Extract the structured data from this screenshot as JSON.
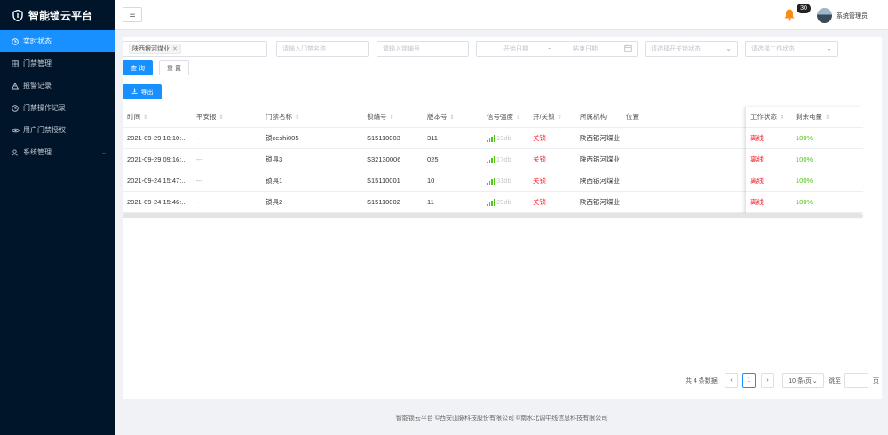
{
  "app": {
    "title": "智能锁云平台"
  },
  "sidebar": {
    "items": [
      {
        "label": "实时状态",
        "icon": "clock-icon",
        "active": true
      },
      {
        "label": "门禁管理",
        "icon": "grid-icon",
        "active": false
      },
      {
        "label": "报警记录",
        "icon": "warning-icon",
        "active": false
      },
      {
        "label": "门禁操作记录",
        "icon": "clock-icon",
        "active": false
      },
      {
        "label": "用户门禁授权",
        "icon": "eye-icon",
        "active": false
      },
      {
        "label": "系统管理",
        "icon": "user-icon",
        "active": false,
        "has_children": true
      }
    ]
  },
  "header": {
    "collapse_icon": "indent-icon",
    "notification_count": "30",
    "user_name": "系统管理员"
  },
  "filters": {
    "org_tag": "陕西银河煤业",
    "door_name_placeholder": "请输入门禁名称",
    "lock_no_placeholder": "请输入锁编号",
    "start_date_placeholder": "开始日期",
    "date_separator": "~",
    "end_date_placeholder": "结束日期",
    "lock_status_placeholder": "请选择开关锁状态",
    "work_status_placeholder": "请选择工作状态",
    "query_label": "查 询",
    "reset_label": "重 置",
    "export_label": "导出"
  },
  "table": {
    "columns": [
      "时间",
      "平安报",
      "门禁名称",
      "锁编号",
      "版本号",
      "信号强度",
      "开/关锁",
      "所属机构",
      "位置",
      "工作状态",
      "剩余电量"
    ],
    "rows": [
      {
        "time": "2021-09-29 10:10:...",
        "safety": "---",
        "door": "锁ceshi005",
        "lock_no": "S15110003",
        "version": "311",
        "signal": "19db",
        "lock_state": "关锁",
        "org": "陕西银河煤业",
        "location": "",
        "work": "离线",
        "battery": "100%"
      },
      {
        "time": "2021-09-29 09:16:...",
        "safety": "---",
        "door": "锁具3",
        "lock_no": "S32130006",
        "version": "025",
        "signal": "17db",
        "lock_state": "关锁",
        "org": "陕西银河煤业",
        "location": "",
        "work": "离线",
        "battery": "100%"
      },
      {
        "time": "2021-09-24 15:47:...",
        "safety": "---",
        "door": "锁具1",
        "lock_no": "S15110001",
        "version": "10",
        "signal": "31db",
        "lock_state": "关锁",
        "org": "陕西银河煤业",
        "location": "",
        "work": "离线",
        "battery": "100%"
      },
      {
        "time": "2021-09-24 15:46:...",
        "safety": "---",
        "door": "锁具2",
        "lock_no": "S15110002",
        "version": "11",
        "signal": "29db",
        "lock_state": "关锁",
        "org": "陕西银河煤业",
        "location": "",
        "work": "离线",
        "battery": "100%"
      }
    ]
  },
  "pagination": {
    "total_text": "共 4 条数据",
    "current_page": "1",
    "page_size": "10 条/页",
    "goto_label": "跳至",
    "page_unit": "页"
  },
  "footer": {
    "text": "智能锁云平台 ©西安山脉科技股份有限公司 ©南水北调中线信息科技有限公司"
  },
  "colors": {
    "primary": "#1890ff",
    "sidebar_bg": "#001529",
    "offline": "#f5222d",
    "battery_ok": "#52c41a",
    "bell": "#fa8c16"
  }
}
